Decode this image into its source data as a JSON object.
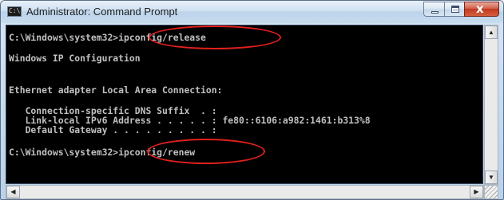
{
  "window": {
    "title": "Administrator: Command Prompt",
    "icon_text": "C:\\"
  },
  "console": {
    "line1_prompt": "C:\\Windows\\system32>",
    "line1_cmd": "ipconfig/release",
    "line2": "Windows IP Configuration",
    "line3": "Ethernet adapter Local Area Connection:",
    "line4": "   Connection-specific DNS Suffix  . :",
    "line5": "   Link-local IPv6 Address . . . . . : fe80::6106:a982:1461:b313%8",
    "line6": "   Default Gateway . . . . . . . . . :",
    "line7_prompt": "C:\\Windows\\system32>",
    "line7_cmd": "ipconfig/renew"
  },
  "icons": {
    "minimize": "minimize-icon",
    "maximize": "maximize-icon",
    "close": "close-icon",
    "scroll_up": "▲",
    "scroll_down": "▼",
    "scroll_left": "◀",
    "scroll_right": "▶"
  },
  "colors": {
    "console_bg": "#000000",
    "console_text": "#c0c0c0",
    "highlight_ring": "#e2201c"
  }
}
